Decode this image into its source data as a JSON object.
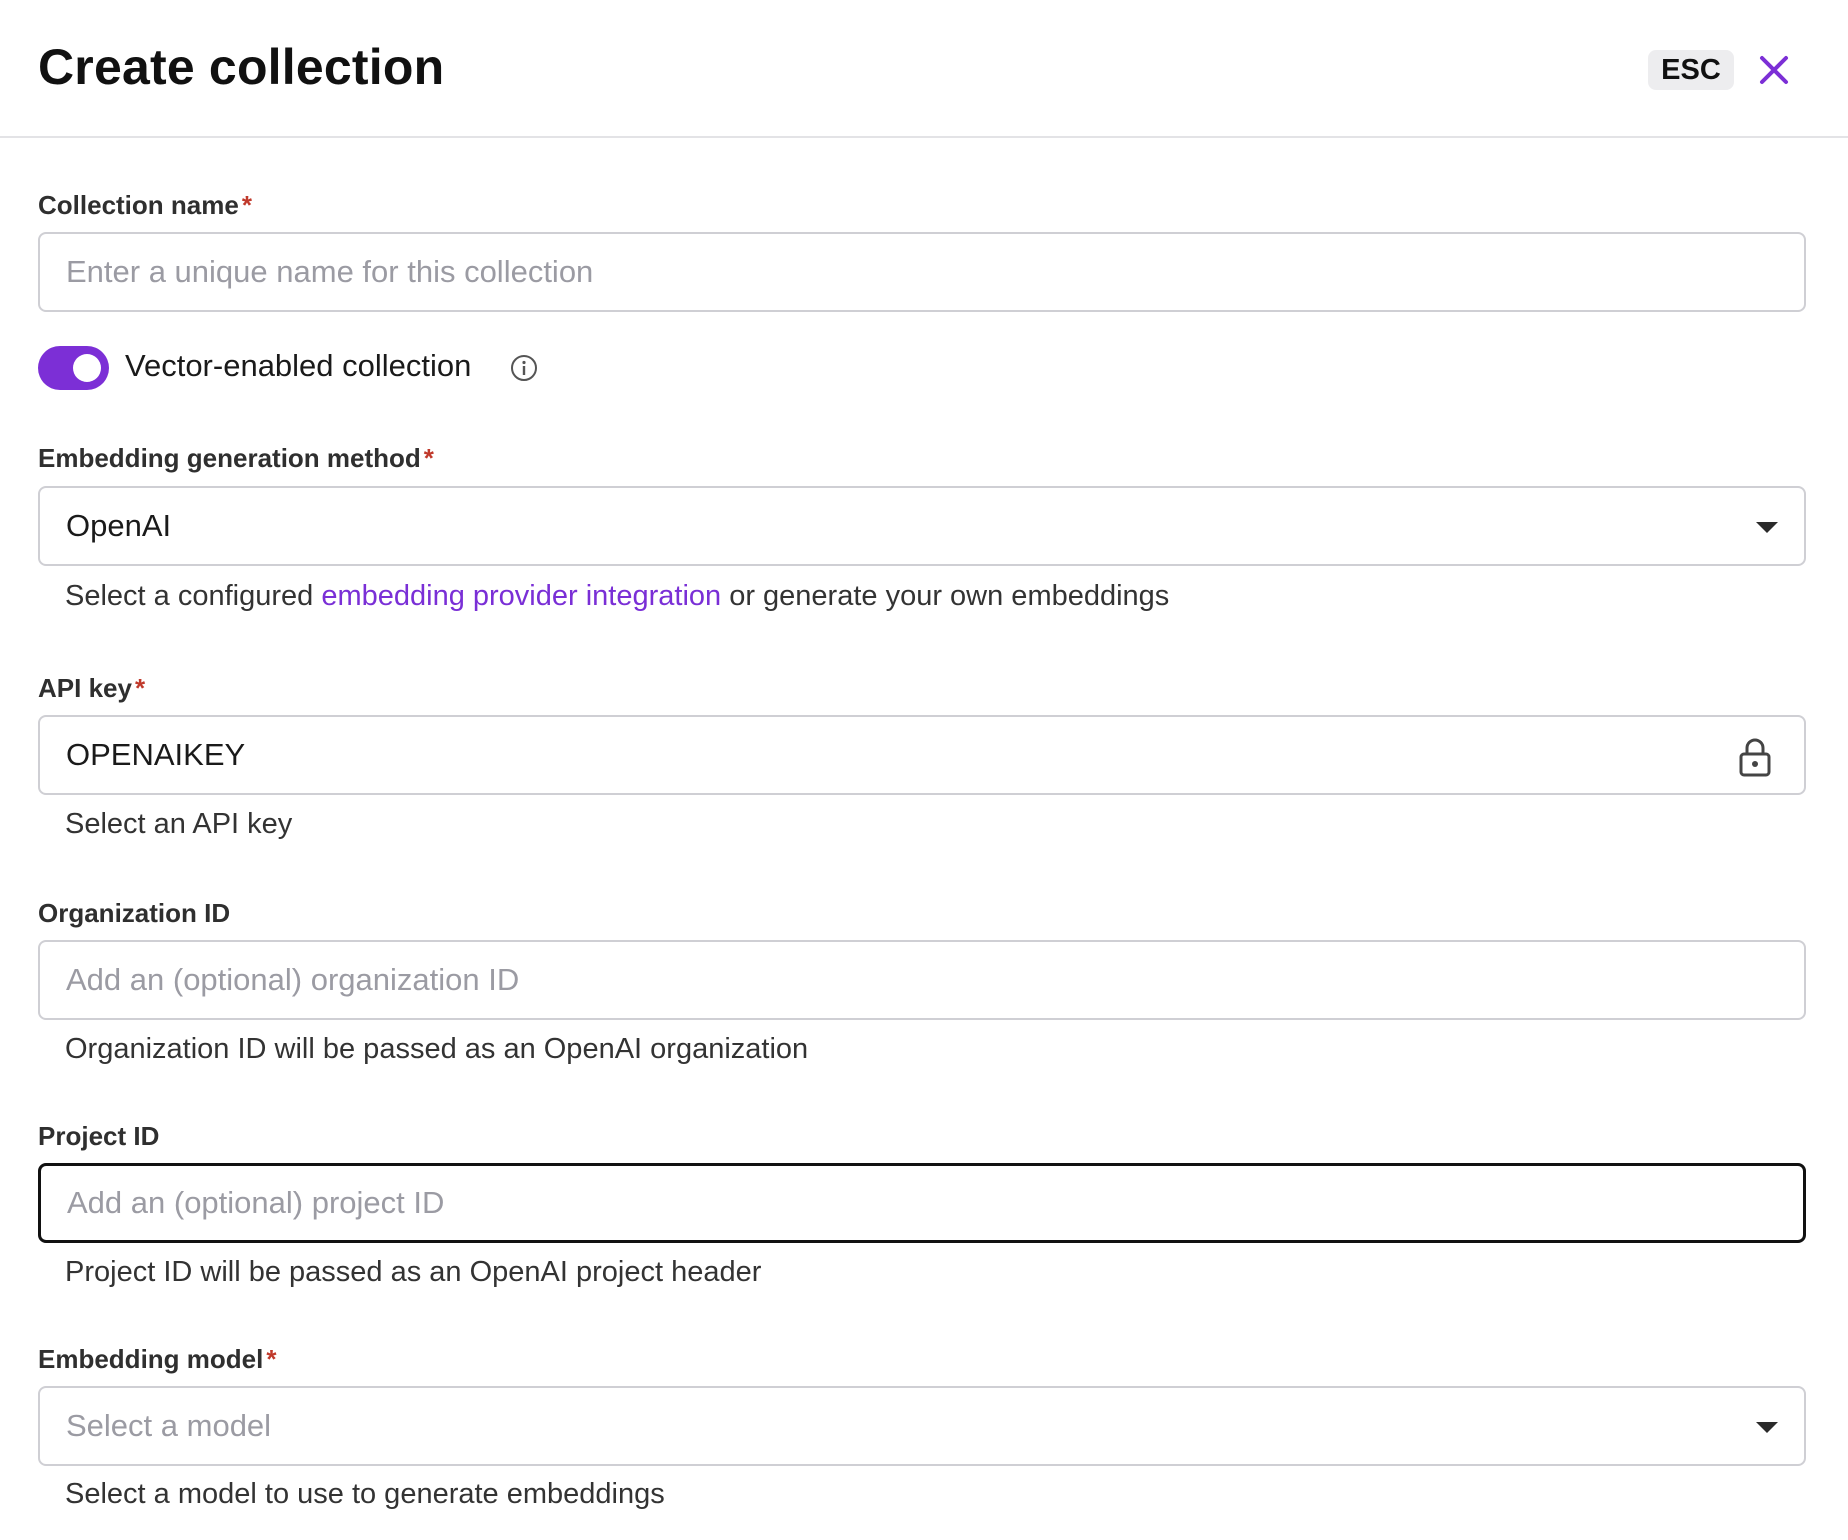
{
  "header": {
    "title": "Create collection",
    "esc_label": "ESC"
  },
  "collection_name": {
    "label": "Collection name",
    "required_mark": "*",
    "placeholder": "Enter a unique name for this collection",
    "value": ""
  },
  "vector_toggle": {
    "label": "Vector-enabled collection",
    "enabled": true
  },
  "embedding_method": {
    "label": "Embedding generation method",
    "required_mark": "*",
    "value": "OpenAI",
    "help_before": "Select a configured ",
    "help_link": "embedding provider integration",
    "help_after": " or generate your own embeddings"
  },
  "api_key": {
    "label": "API key",
    "required_mark": "*",
    "value": "OPENAIKEY",
    "help": "Select an API key"
  },
  "organization_id": {
    "label": "Organization ID",
    "placeholder": "Add an (optional) organization ID",
    "help": "Organization ID will be passed as an OpenAI organization"
  },
  "project_id": {
    "label": "Project ID",
    "placeholder": "Add an (optional) project ID",
    "help": "Project ID will be passed as an OpenAI project header"
  },
  "embedding_model": {
    "label": "Embedding model",
    "required_mark": "*",
    "placeholder": "Select a model",
    "help": "Select a model to use to generate embeddings"
  },
  "colors": {
    "accent": "#7c2fd6",
    "required": "#c0392b",
    "border": "#cfcfd4"
  }
}
